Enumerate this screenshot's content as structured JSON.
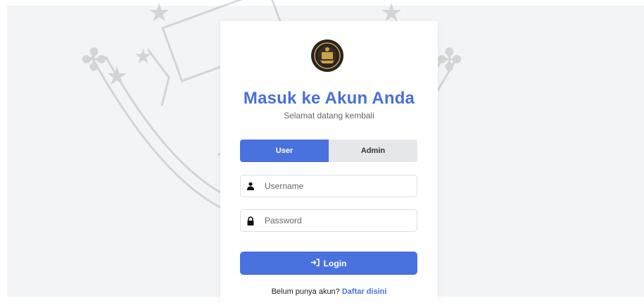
{
  "header": {
    "title": "Masuk ke Akun Anda",
    "subtitle": "Selamat datang kembali"
  },
  "tabs": [
    {
      "label": "User",
      "active": true
    },
    {
      "label": "Admin",
      "active": false
    }
  ],
  "form": {
    "username_placeholder": "Username",
    "password_placeholder": "Password",
    "login_label": "Login"
  },
  "footer": {
    "question": "Belum punya akun?",
    "link": "Daftar disini"
  },
  "colors": {
    "accent": "#4a72de",
    "title": "#4a6fd8"
  },
  "icons": [
    "university-seal",
    "user-icon",
    "lock-icon",
    "login-icon"
  ]
}
